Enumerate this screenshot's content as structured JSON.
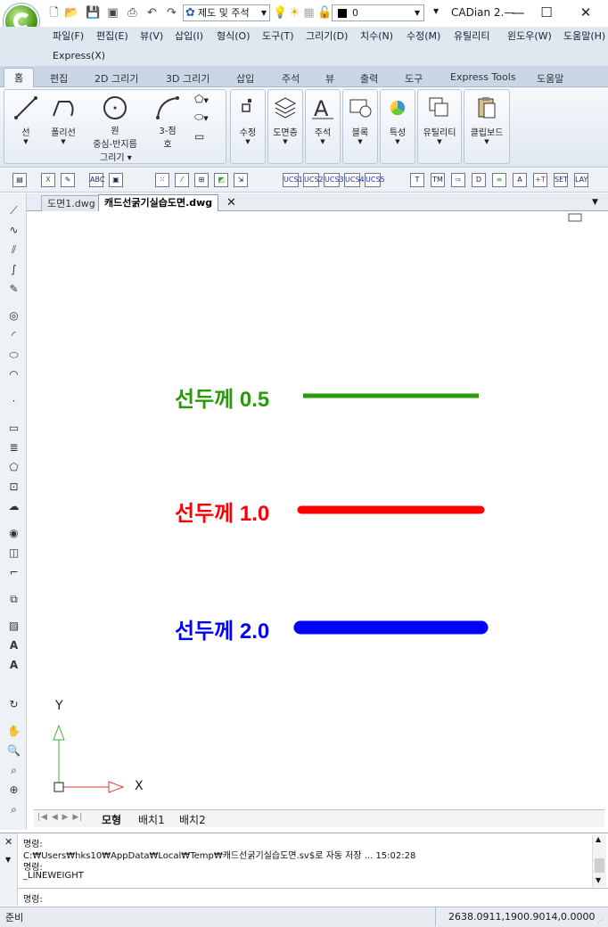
{
  "titlebar": {
    "app_title": "CADian 2.—",
    "layer_combo": "제도 및 주석",
    "layer_value": "0",
    "minimize": "—",
    "maximize": "☐",
    "close": "✕"
  },
  "menu": {
    "row1": [
      "파일(F)",
      "편집(E)",
      "뷰(V)",
      "삽입(I)",
      "형식(O)",
      "도구(T)",
      "그리기(D)",
      "치수(N)",
      "수정(M)",
      "유틸리티",
      "윈도우(W)",
      "도움말(H)"
    ],
    "row2": [
      "Express(X)"
    ]
  },
  "ribbon_tabs": [
    "홈",
    "편집",
    "2D 그리기",
    "3D 그리기",
    "삽입",
    "주석",
    "뷰",
    "출력",
    "도구",
    "Express Tools",
    "도움말"
  ],
  "ribbon": {
    "draw_group_label": "그리기",
    "line": "선",
    "polyline": "폴리선",
    "circle": "원",
    "circle_sub": "중심-반지름",
    "arc": "3-점",
    "arc_sub": "호",
    "modify": "수정",
    "layers": "도면층",
    "annotation": "주석",
    "block": "블록",
    "properties": "특성",
    "utility": "유틸리티",
    "clipboard": "클립보드"
  },
  "toolbar_ucs": [
    "UCS1",
    "UCS2",
    "UCS3",
    "UCS4",
    "UCS5"
  ],
  "doc_tabs": [
    "도면1.dwg",
    "캐드선굵기실습도면.dwg"
  ],
  "canvas": {
    "labels": [
      {
        "text": "선두께 0.5",
        "color": "#2a9a0a",
        "lineweight": 0.5
      },
      {
        "text": "선두께 1.0",
        "color": "#ff0000",
        "lineweight": 1.0
      },
      {
        "text": "선두께 2.0",
        "color": "#0000ff",
        "lineweight": 2.0
      }
    ],
    "axis_x": "X",
    "axis_y": "Y"
  },
  "layout_tabs": [
    "모형",
    "배치1",
    "배치2"
  ],
  "command": {
    "lines": [
      "명령:",
      "C:₩Users₩hks10₩AppData₩Local₩Temp₩캐드선굵기실습도면.sv$로 자동 저장 ... 15:02:28",
      "명령:",
      "_LINEWEIGHT"
    ],
    "prompt": "명령:"
  },
  "status": {
    "ready": "준비",
    "coords": "2638.0911,1900.9014,0.0000"
  }
}
